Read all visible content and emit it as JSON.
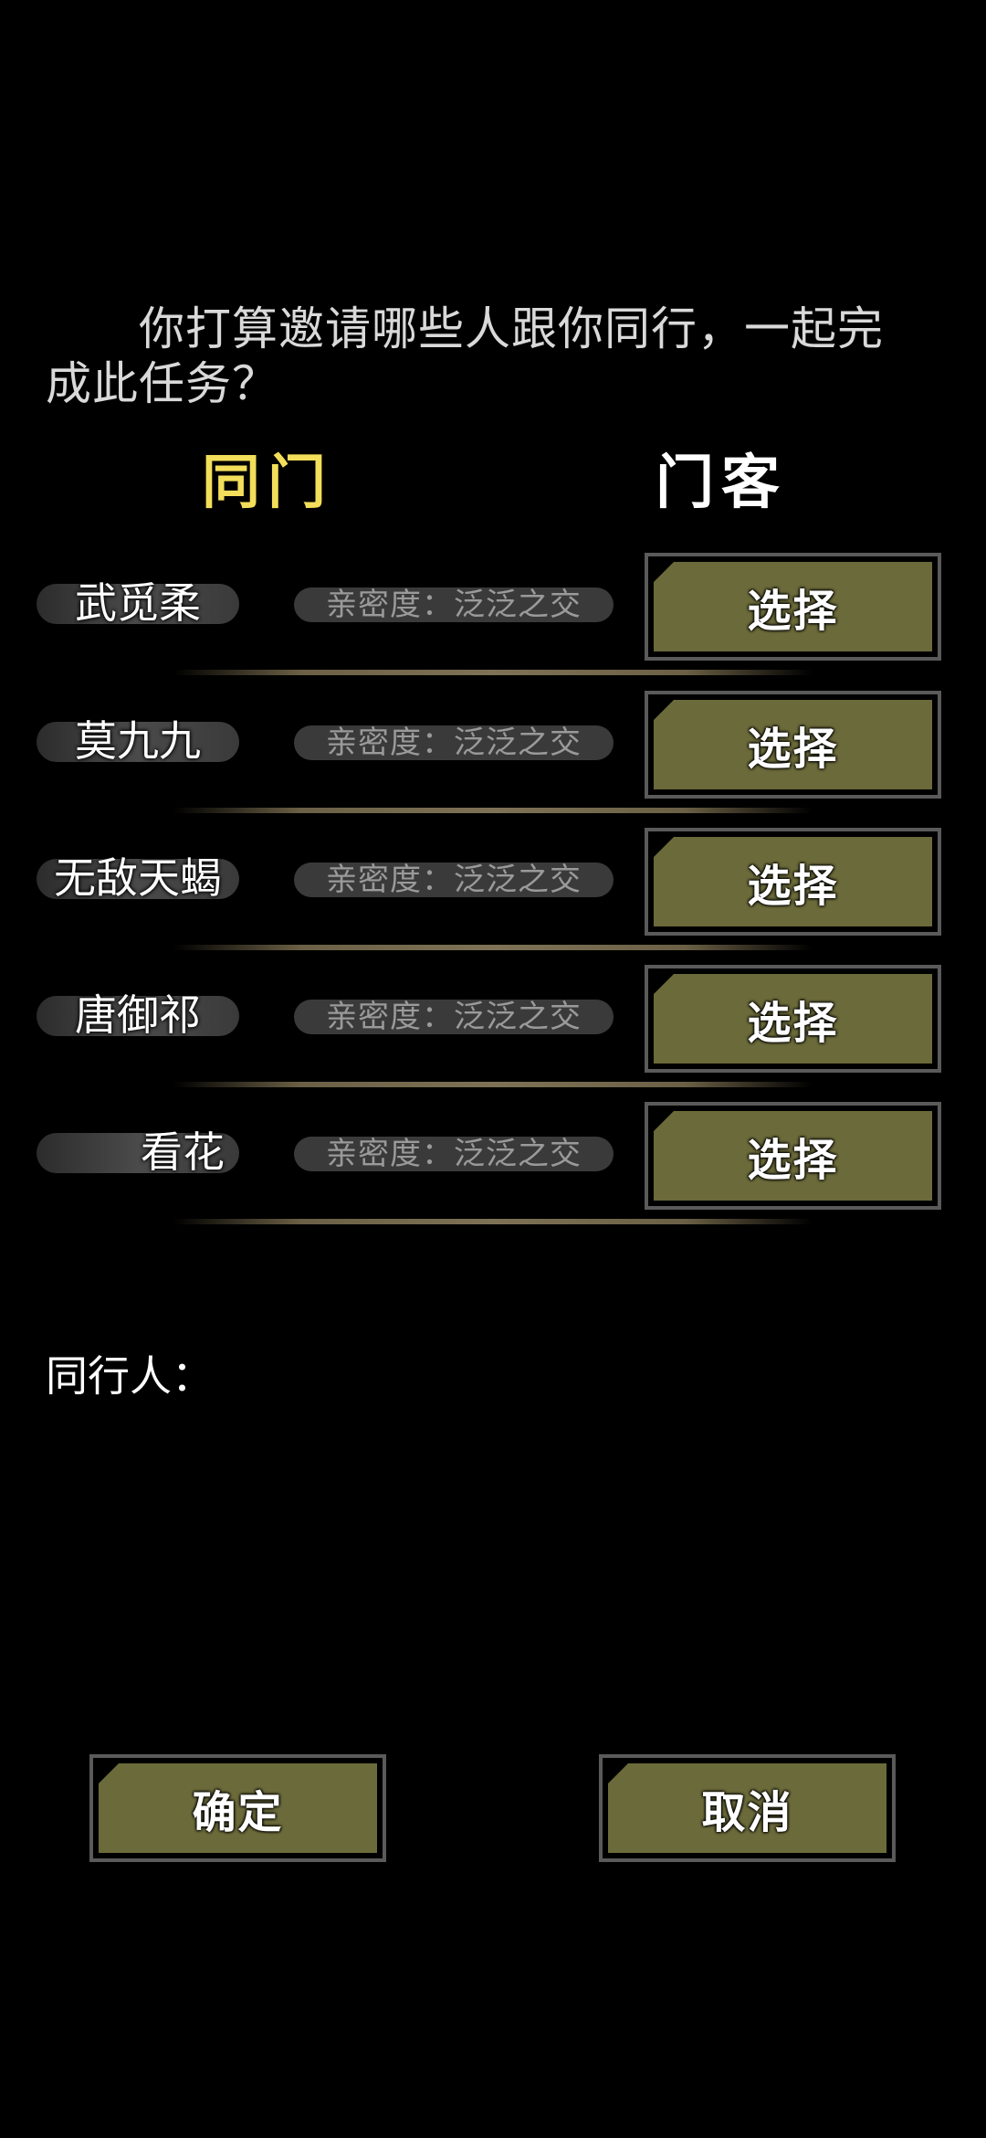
{
  "prompt": "你打算邀请哪些人跟你同行，一起完成此任务？",
  "tabs": [
    {
      "label": "同门",
      "active": true
    },
    {
      "label": "门客",
      "active": false
    }
  ],
  "affinity_label": "亲密度：泛泛之交",
  "select_label": "选择",
  "members": [
    {
      "name": "武觅柔",
      "affinity": "亲密度：泛泛之交"
    },
    {
      "name": "莫九九",
      "affinity": "亲密度：泛泛之交"
    },
    {
      "name": "无敌天蝎",
      "affinity": "亲密度：泛泛之交"
    },
    {
      "name": "唐御祁",
      "affinity": "亲密度：泛泛之交"
    },
    {
      "name": "看花",
      "affinity": "亲密度：泛泛之交"
    }
  ],
  "companions_label": "同行人：",
  "buttons": {
    "confirm": "确定",
    "cancel": "取消"
  },
  "colors": {
    "background": "#000000",
    "button_face": "#6b6a3a",
    "tab_active": "#f2de5a",
    "divider": "#7e7256"
  }
}
